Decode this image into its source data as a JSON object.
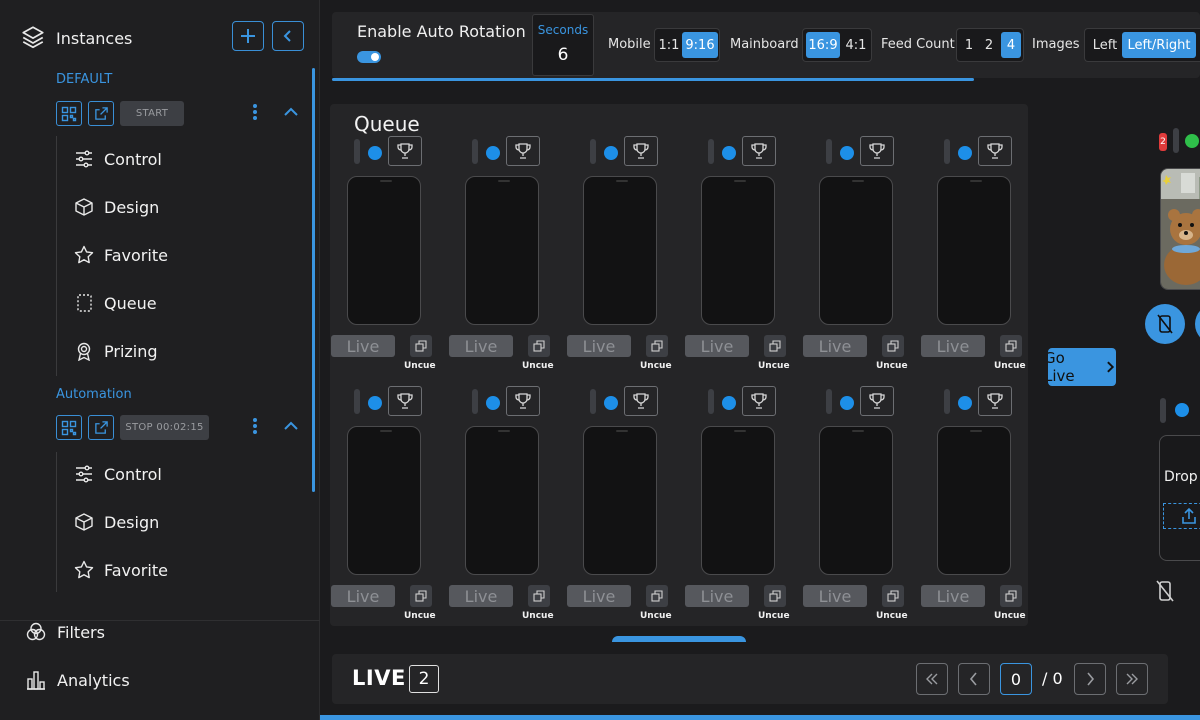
{
  "sidebar": {
    "title": "Instances",
    "groups": [
      {
        "label": "DEFAULT",
        "status_label": "START",
        "items": [
          {
            "label": "Control",
            "icon": "sliders-icon"
          },
          {
            "label": "Design",
            "icon": "cube-icon"
          },
          {
            "label": "Favorite",
            "icon": "star-icon"
          },
          {
            "label": "Queue",
            "icon": "queue-icon"
          },
          {
            "label": "Prizing",
            "icon": "award-icon"
          }
        ]
      },
      {
        "label": "Automation",
        "status_label": "STOP 00:02:15",
        "items": [
          {
            "label": "Control",
            "icon": "sliders-icon"
          },
          {
            "label": "Design",
            "icon": "cube-icon"
          },
          {
            "label": "Favorite",
            "icon": "star-icon"
          }
        ]
      }
    ],
    "footer": [
      {
        "label": "Filters",
        "icon": "filters-icon"
      },
      {
        "label": "Analytics",
        "icon": "analytics-icon"
      }
    ]
  },
  "topbar": {
    "auto_rotation_label": "Enable Auto Rotation",
    "auto_rotation_on": true,
    "seconds_label": "Seconds",
    "seconds_value": "6",
    "mobile": {
      "label": "Mobile",
      "options": [
        "1:1",
        "9:16"
      ],
      "selected": "9:16"
    },
    "mainboard": {
      "label": "Mainboard",
      "options": [
        "16:9",
        "4:1"
      ],
      "selected": "16:9"
    },
    "feed_count": {
      "label": "Feed Count",
      "options": [
        "1",
        "2",
        "4"
      ],
      "selected": "4"
    },
    "images": {
      "label": "Images",
      "options": [
        "Left",
        "Left/Right"
      ],
      "selected": "Left/Right"
    }
  },
  "queue": {
    "title": "Queue",
    "card_live_label": "Live",
    "card_uncue_label": "Uncue",
    "card_count": 12
  },
  "go_live_label": "Go Live",
  "right_panel": {
    "badge": "2",
    "drop_label": "Drop he"
  },
  "live_bar": {
    "label": "LIVE",
    "count": "2",
    "page": "0",
    "total": "/ 0"
  },
  "colors": {
    "accent": "#3a95e0",
    "dot": "#1d8fe8",
    "green": "#2fbf4a",
    "red_badge": "#e03b3b"
  }
}
